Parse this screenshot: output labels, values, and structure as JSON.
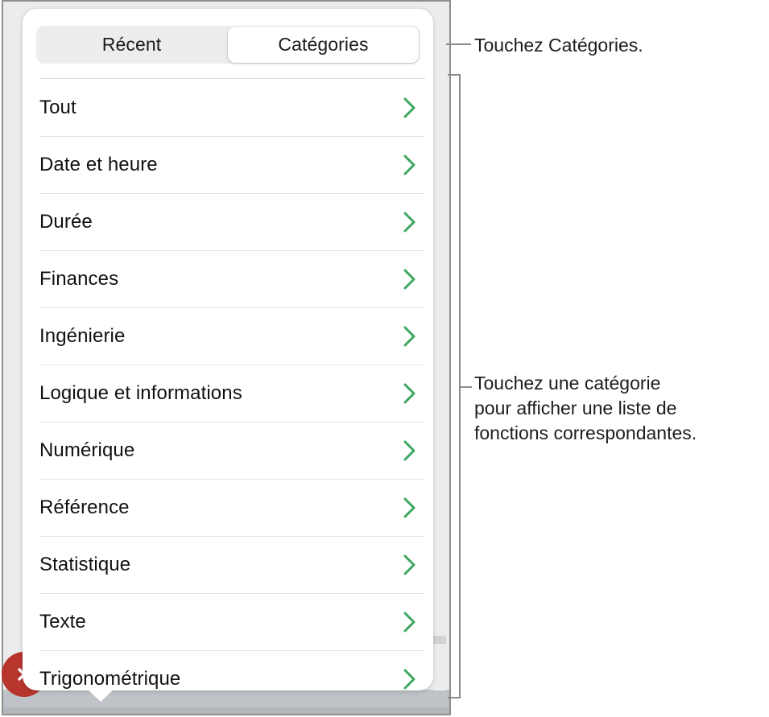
{
  "window": {
    "background_color": "#ebeceb",
    "border_color": "#8e8e8e"
  },
  "popover": {
    "background_color": "#ffffff",
    "segmented_control": {
      "name": "function-browser-tabs",
      "track_color": "#ededed",
      "tabs": [
        {
          "label": "Récent",
          "selected": false
        },
        {
          "label": "Catégories",
          "selected": true
        }
      ]
    },
    "list": {
      "name": "function-category-list",
      "chevron_color": "#3ea860",
      "chevron_icon": "chevron-right-icon",
      "items": [
        {
          "label": "Tout"
        },
        {
          "label": "Date et heure"
        },
        {
          "label": "Durée"
        },
        {
          "label": "Finances"
        },
        {
          "label": "Ingénierie"
        },
        {
          "label": "Logique et informations"
        },
        {
          "label": "Numérique"
        },
        {
          "label": "Référence"
        },
        {
          "label": "Statistique"
        },
        {
          "label": "Texte"
        },
        {
          "label": "Trigonométrique"
        }
      ]
    }
  },
  "close_badge": {
    "name": "close-button",
    "icon": "close-x-icon",
    "color": "#b8352e"
  },
  "callouts": [
    {
      "id": "tabs",
      "text": "Touchez Catégories.",
      "leader": "horizontal-line"
    },
    {
      "id": "list",
      "text": "Touchez une catégorie\npour afficher une liste de\nfonctions correspondantes.",
      "leader": "bracket"
    }
  ],
  "colors": {
    "accent_green": "#3ea860",
    "callout_line": "#8a8a8a",
    "text_primary": "#111111",
    "separator": "#e3e3e3"
  }
}
